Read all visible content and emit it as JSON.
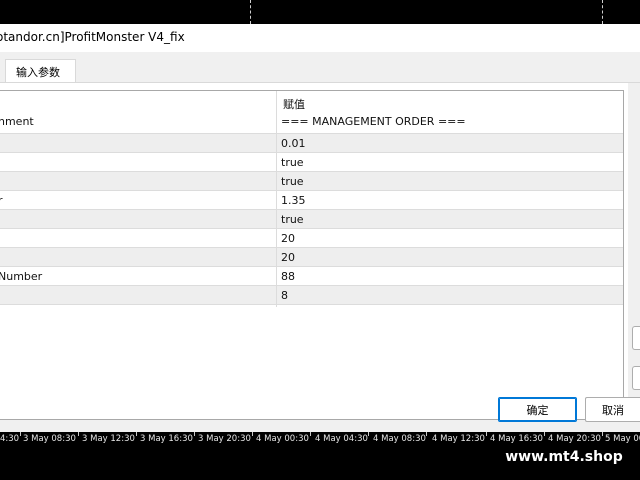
{
  "window": {
    "title": "otandor.cn]ProfitMonster V4_fix"
  },
  "tabs": [
    {
      "label": "输入参数"
    }
  ],
  "table": {
    "columns": [
      "",
      "赋值"
    ],
    "header_row": {
      "name": "nment",
      "value": "=== MANAGEMENT ORDER ==="
    },
    "rows": [
      {
        "name": "",
        "value": "0.01"
      },
      {
        "name": "",
        "value": "true"
      },
      {
        "name": "",
        "value": "true"
      },
      {
        "name": "r",
        "value": "1.35"
      },
      {
        "name": "",
        "value": "true"
      },
      {
        "name": "",
        "value": "20"
      },
      {
        "name": "",
        "value": "20"
      },
      {
        "name": "Number",
        "value": "88"
      },
      {
        "name": "",
        "value": "8"
      }
    ]
  },
  "buttons": {
    "ok": "确定",
    "cancel": "取消"
  },
  "time_axis": [
    "4:30",
    "3 May 08:30",
    "3 May 12:30",
    "3 May 16:30",
    "3 May 20:30",
    "4 May 00:30",
    "4 May 04:30",
    "4 May 08:30",
    "4 May 12:30",
    "4 May 16:30",
    "4 May 20:30",
    "5 May 00:30",
    "5 May 04:30"
  ],
  "watermark": "www.mt4.shop",
  "colors": {
    "accent": "#0078d7",
    "row_alt": "#eeeeee",
    "chart_bg": "#000000"
  }
}
